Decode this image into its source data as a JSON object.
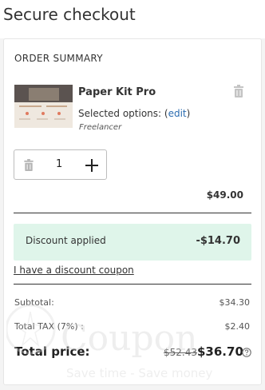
{
  "header": {
    "title": "Secure checkout"
  },
  "summary": {
    "title": "ORDER SUMMARY",
    "item": {
      "name": "Paper Kit Pro",
      "options_prefix": "Selected options: (",
      "edit_label": "edit",
      "options_suffix": ")",
      "option_value": "Freelancer",
      "quantity": "1",
      "line_price": "$49.00"
    },
    "discount": {
      "label": "Discount applied",
      "amount": "-$14.70"
    },
    "coupon_link": "I have a discount coupon",
    "subtotal": {
      "label": "Subtotal:",
      "value": "$34.30"
    },
    "tax": {
      "label": "Total TAX (7%) :",
      "value": "$2.40"
    },
    "total": {
      "label": "Total price:",
      "old_price": "$52.43",
      "price": "$36.70"
    }
  },
  "colors": {
    "discount_bg": "#dff5ea",
    "link": "#2b6cb0"
  },
  "icons": [
    "trash-icon",
    "plus-icon",
    "question-circle-icon"
  ]
}
